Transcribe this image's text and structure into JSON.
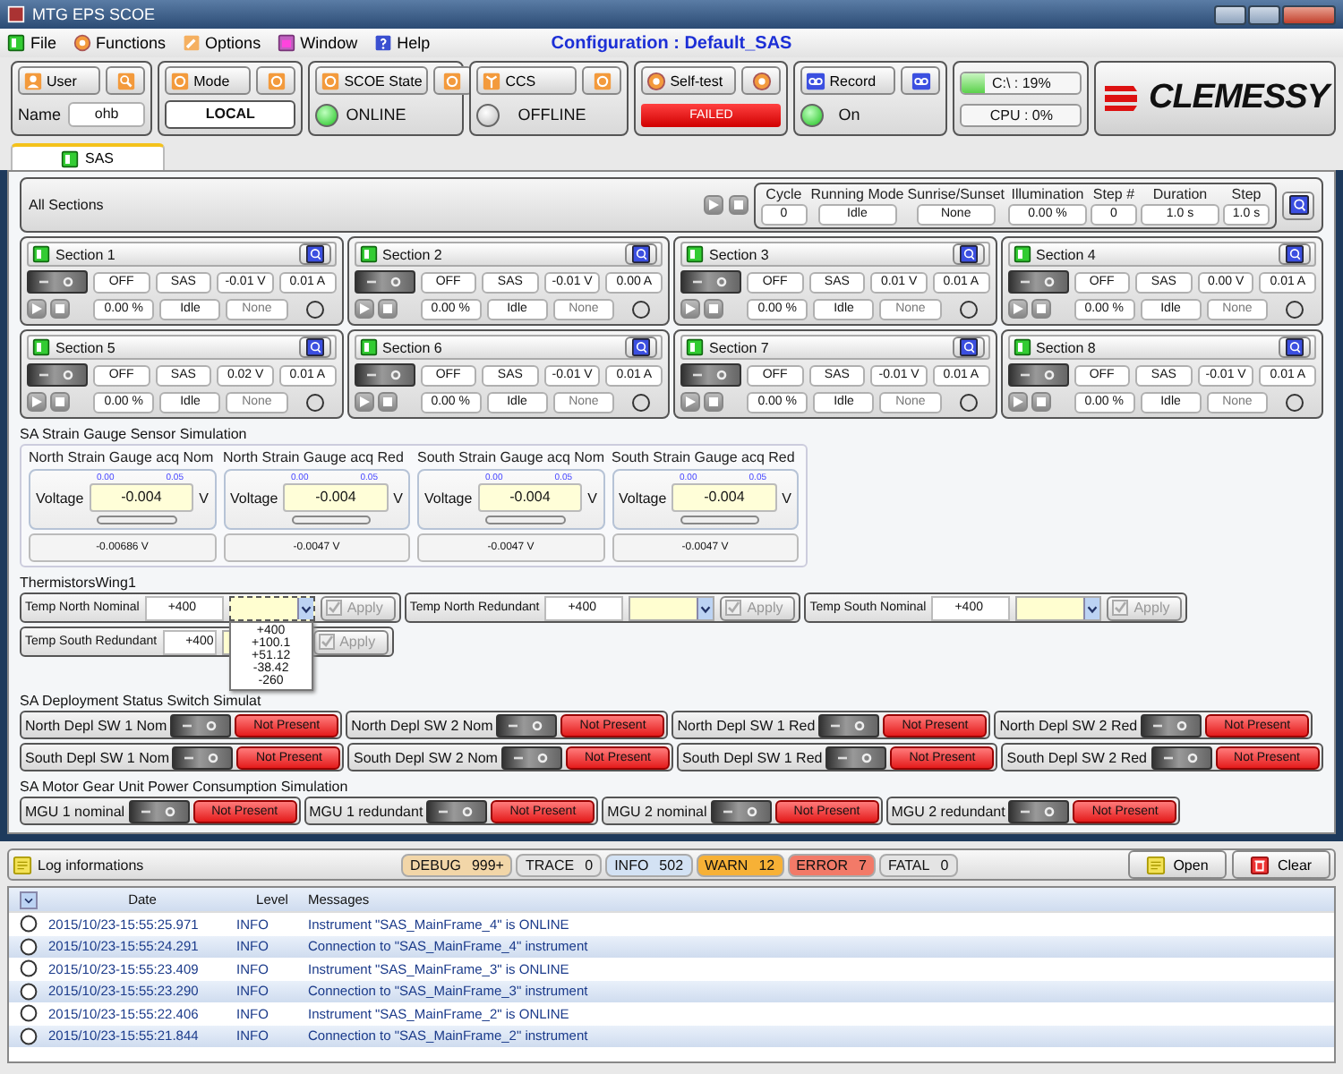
{
  "window": {
    "title": "MTG EPS SCOE"
  },
  "menu": [
    {
      "label": "File"
    },
    {
      "label": "Functions"
    },
    {
      "label": "Options"
    },
    {
      "label": "Window"
    },
    {
      "label": "Help"
    }
  ],
  "configuration": "Configuration : Default_SAS",
  "header": {
    "user": {
      "label": "User",
      "name_label": "Name",
      "name": "ohb"
    },
    "mode": {
      "label": "Mode",
      "value": "LOCAL"
    },
    "scoe_state": {
      "label": "SCOE State",
      "status": "ONLINE",
      "on": true
    },
    "ccs": {
      "label": "CCS",
      "status": "OFFLINE",
      "on": false
    },
    "self_test": {
      "label": "Self-test",
      "status": "FAILED",
      "failed": true
    },
    "record": {
      "label": "Record",
      "status": "On",
      "on": true
    },
    "resources": [
      {
        "label": "C:\\ : 19%",
        "level": 0.19
      },
      {
        "label": "CPU : 0%",
        "level": 0
      }
    ],
    "logo": "CLEMESSY"
  },
  "tabs": [
    {
      "label": "SAS",
      "selected": true
    }
  ],
  "all_sections": {
    "label": "All Sections",
    "fields": [
      {
        "name": "Cycle",
        "value": "0"
      },
      {
        "name": "Running Mode",
        "value": "Idle"
      },
      {
        "name": "Sunrise/Sunset",
        "value": "None"
      },
      {
        "name": "Illumination",
        "value": "0.00 %"
      },
      {
        "name": "Step #",
        "value": "0"
      },
      {
        "name": "Duration",
        "value": "1.0 s"
      },
      {
        "name": "Step",
        "value": "1.0 s"
      }
    ]
  },
  "sections": [
    {
      "title": "Section 1",
      "state": "OFF",
      "mode": "SAS",
      "voltage": "-0.01 V",
      "current": "0.01 A",
      "percent": "0.00 %",
      "status": "Idle",
      "sun": "None",
      "led": false,
      "on": false
    },
    {
      "title": "Section 2",
      "state": "OFF",
      "mode": "SAS",
      "voltage": "-0.01 V",
      "current": "0.00 A",
      "percent": "0.00 %",
      "status": "Idle",
      "sun": "None",
      "led": false,
      "on": false
    },
    {
      "title": "Section 3",
      "state": "OFF",
      "mode": "SAS",
      "voltage": "0.01 V",
      "current": "0.01 A",
      "percent": "0.00 %",
      "status": "Idle",
      "sun": "None",
      "led": false,
      "on": false
    },
    {
      "title": "Section 4",
      "state": "OFF",
      "mode": "SAS",
      "voltage": "0.00 V",
      "current": "0.01 A",
      "percent": "0.00 %",
      "status": "Idle",
      "sun": "None",
      "led": false,
      "on": false
    },
    {
      "title": "Section 5",
      "state": "OFF",
      "mode": "SAS",
      "voltage": "0.02 V",
      "current": "0.01 A",
      "percent": "0.00 %",
      "status": "Idle",
      "sun": "None",
      "led": false,
      "on": false
    },
    {
      "title": "Section 6",
      "state": "OFF",
      "mode": "SAS",
      "voltage": "-0.01 V",
      "current": "0.01 A",
      "percent": "0.00 %",
      "status": "Idle",
      "sun": "None",
      "led": false,
      "on": false
    },
    {
      "title": "Section 7",
      "state": "OFF",
      "mode": "SAS",
      "voltage": "-0.01 V",
      "current": "0.01 A",
      "percent": "0.00 %",
      "status": "Idle",
      "sun": "None",
      "led": false,
      "on": false
    },
    {
      "title": "Section 8",
      "state": "OFF",
      "mode": "SAS",
      "voltage": "-0.01 V",
      "current": "0.01 A",
      "percent": "0.00 %",
      "status": "Idle",
      "sun": "None",
      "led": false,
      "on": false
    }
  ],
  "strain_gauge": {
    "title": "SA Strain Gauge Sensor Simulation",
    "channels": [
      {
        "title": "North Strain Gauge acq Nom",
        "label": "Voltage",
        "min": "0.00",
        "max": "0.05",
        "value": "-0.004",
        "unit": "V",
        "level": 0,
        "reading": "-0.00686 V"
      },
      {
        "title": "North Strain Gauge acq Red",
        "label": "Voltage",
        "min": "0.00",
        "max": "0.05",
        "value": "-0.004",
        "unit": "V",
        "level": 0,
        "reading": "-0.0047 V"
      },
      {
        "title": "South Strain Gauge acq Nom",
        "label": "Voltage",
        "min": "0.00",
        "max": "0.05",
        "value": "-0.004",
        "unit": "V",
        "level": 0,
        "reading": "-0.0047 V"
      },
      {
        "title": "South Strain Gauge acq Red",
        "label": "Voltage",
        "min": "0.00",
        "max": "0.05",
        "value": "-0.004",
        "unit": "V",
        "level": 0,
        "reading": "-0.0047 V"
      }
    ]
  },
  "thermistors": {
    "title": "ThermistorsWing1",
    "items": [
      {
        "label": "Temp North Nominal",
        "value": "+400",
        "button": "Apply",
        "disabled": true,
        "expanded": true,
        "options": [
          "+400",
          "+100.1",
          "+51.12",
          "-38.42",
          "-260"
        ]
      },
      {
        "label": "Temp North Redundant",
        "value": "+400",
        "button": "Apply",
        "disabled": true,
        "expanded": false
      },
      {
        "label": "Temp South Nominal",
        "value": "+400",
        "button": "Apply",
        "disabled": true,
        "expanded": false
      },
      {
        "label": "Temp South Redundant",
        "value": "+400",
        "button": "Apply",
        "disabled": true,
        "expanded": false
      }
    ]
  },
  "deployment": {
    "title": "SA Deployment Status Switch Simulat",
    "items": [
      {
        "label": "North Depl SW 1 Nom",
        "status": "Not Present",
        "on": false
      },
      {
        "label": "North Depl SW 2 Nom",
        "status": "Not Present",
        "on": false
      },
      {
        "label": "North Depl SW 1 Red",
        "status": "Not Present",
        "on": false
      },
      {
        "label": "North Depl SW 2 Red",
        "status": "Not Present",
        "on": false
      },
      {
        "label": "South Depl SW 1 Nom",
        "status": "Not Present",
        "on": false
      },
      {
        "label": "South Depl SW 2 Nom",
        "status": "Not Present",
        "on": false
      },
      {
        "label": "South Depl SW 1 Red",
        "status": "Not Present",
        "on": false
      },
      {
        "label": "South Depl SW 2 Red",
        "status": "Not Present",
        "on": false
      }
    ]
  },
  "mgu": {
    "title": "SA Motor Gear Unit Power Consumption Simulation",
    "items": [
      {
        "label": "MGU 1 nominal",
        "status": "Not Present",
        "on": false
      },
      {
        "label": "MGU 1 redundant",
        "status": "Not Present",
        "on": false
      },
      {
        "label": "MGU 2 nominal",
        "status": "Not Present",
        "on": false
      },
      {
        "label": "MGU 2 redundant",
        "status": "Not Present",
        "on": false
      }
    ]
  },
  "log": {
    "title": "Log informations",
    "counters": [
      {
        "label": "DEBUG",
        "value": "999+",
        "color": "#f2d6a8"
      },
      {
        "label": "TRACE",
        "value": "0",
        "color": "#e4e4e4"
      },
      {
        "label": "INFO",
        "value": "502",
        "color": "#d3e2f4"
      },
      {
        "label": "WARN",
        "value": "12",
        "color": "#f7b136"
      },
      {
        "label": "ERROR",
        "value": "7",
        "color": "#f27a68"
      },
      {
        "label": "FATAL",
        "value": "0",
        "color": "#e4e4e4"
      }
    ],
    "buttons": [
      {
        "label": "Open",
        "kind": "open"
      },
      {
        "label": "Clear",
        "kind": "clear"
      }
    ],
    "columns": [
      "Date",
      "Level",
      "Messages"
    ],
    "rows": [
      {
        "date": "2015/10/23-15:55:25.971",
        "level": "INFO",
        "message": "Instrument \"SAS_MainFrame_4\" is ONLINE"
      },
      {
        "date": "2015/10/23-15:55:24.291",
        "level": "INFO",
        "message": "Connection to \"SAS_MainFrame_4\" instrument"
      },
      {
        "date": "2015/10/23-15:55:23.409",
        "level": "INFO",
        "message": "Instrument \"SAS_MainFrame_3\" is ONLINE"
      },
      {
        "date": "2015/10/23-15:55:23.290",
        "level": "INFO",
        "message": "Connection to \"SAS_MainFrame_3\" instrument"
      },
      {
        "date": "2015/10/23-15:55:22.406",
        "level": "INFO",
        "message": "Instrument \"SAS_MainFrame_2\" is ONLINE"
      },
      {
        "date": "2015/10/23-15:55:21.844",
        "level": "INFO",
        "message": "Connection to \"SAS_MainFrame_2\" instrument"
      }
    ]
  }
}
